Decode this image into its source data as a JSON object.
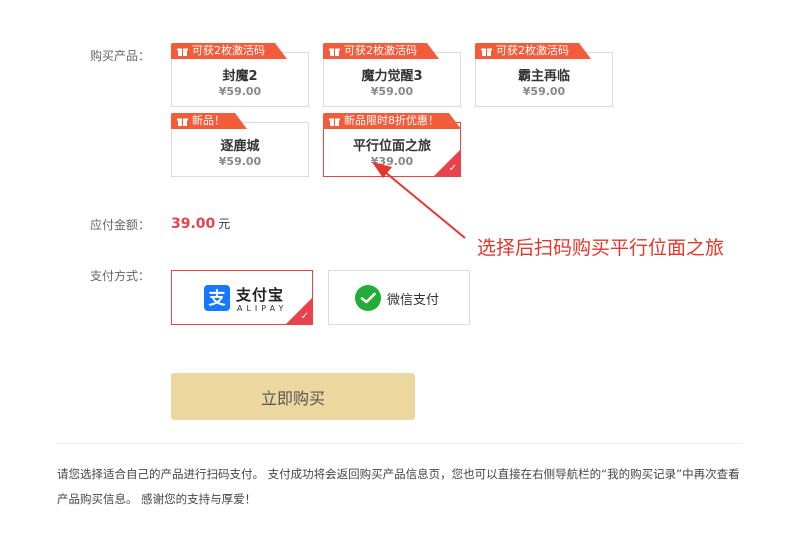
{
  "labels": {
    "product": "购买产品：",
    "amount": "应付金额：",
    "payment": "支付方式："
  },
  "products": [
    {
      "badge": "可获2枚激活码",
      "name": "封魔2",
      "price": "¥59.00",
      "selected": false
    },
    {
      "badge": "可获2枚激活码",
      "name": "魔力觉醒3",
      "price": "¥59.00",
      "selected": false
    },
    {
      "badge": "可获2枚激活码",
      "name": "霸主再临",
      "price": "¥59.00",
      "selected": false
    },
    {
      "badge": "新品！",
      "name": "逐鹿城",
      "price": "¥59.00",
      "selected": false
    },
    {
      "badge": "新品限时8折优惠！",
      "name": "平行位面之旅",
      "price": "¥39.00",
      "selected": true
    }
  ],
  "amount": {
    "value": "39.00",
    "unit": "元"
  },
  "payment": {
    "alipay": {
      "name": "支付宝",
      "sub": "ALIPAY",
      "icon": "alipay-icon",
      "selected": true
    },
    "wechat": {
      "name": "微信支付",
      "icon": "wechat-pay-icon",
      "selected": false
    }
  },
  "buy_button": "立即购买",
  "notice": "请您选择适合自己的产品进行扫码支付。 支付成功将会返回购买产品信息页，您也可以直接在右侧导航栏的“我的购买记录”中再次查看产品购买信息。 感谢您的支持与厚爱！",
  "annotation": "选择后扫码购买平行位面之旅",
  "colors": {
    "accent": "#e8434d",
    "badge": "#f25c3a",
    "button": "#ecd89e",
    "annotation": "#e8352b"
  }
}
